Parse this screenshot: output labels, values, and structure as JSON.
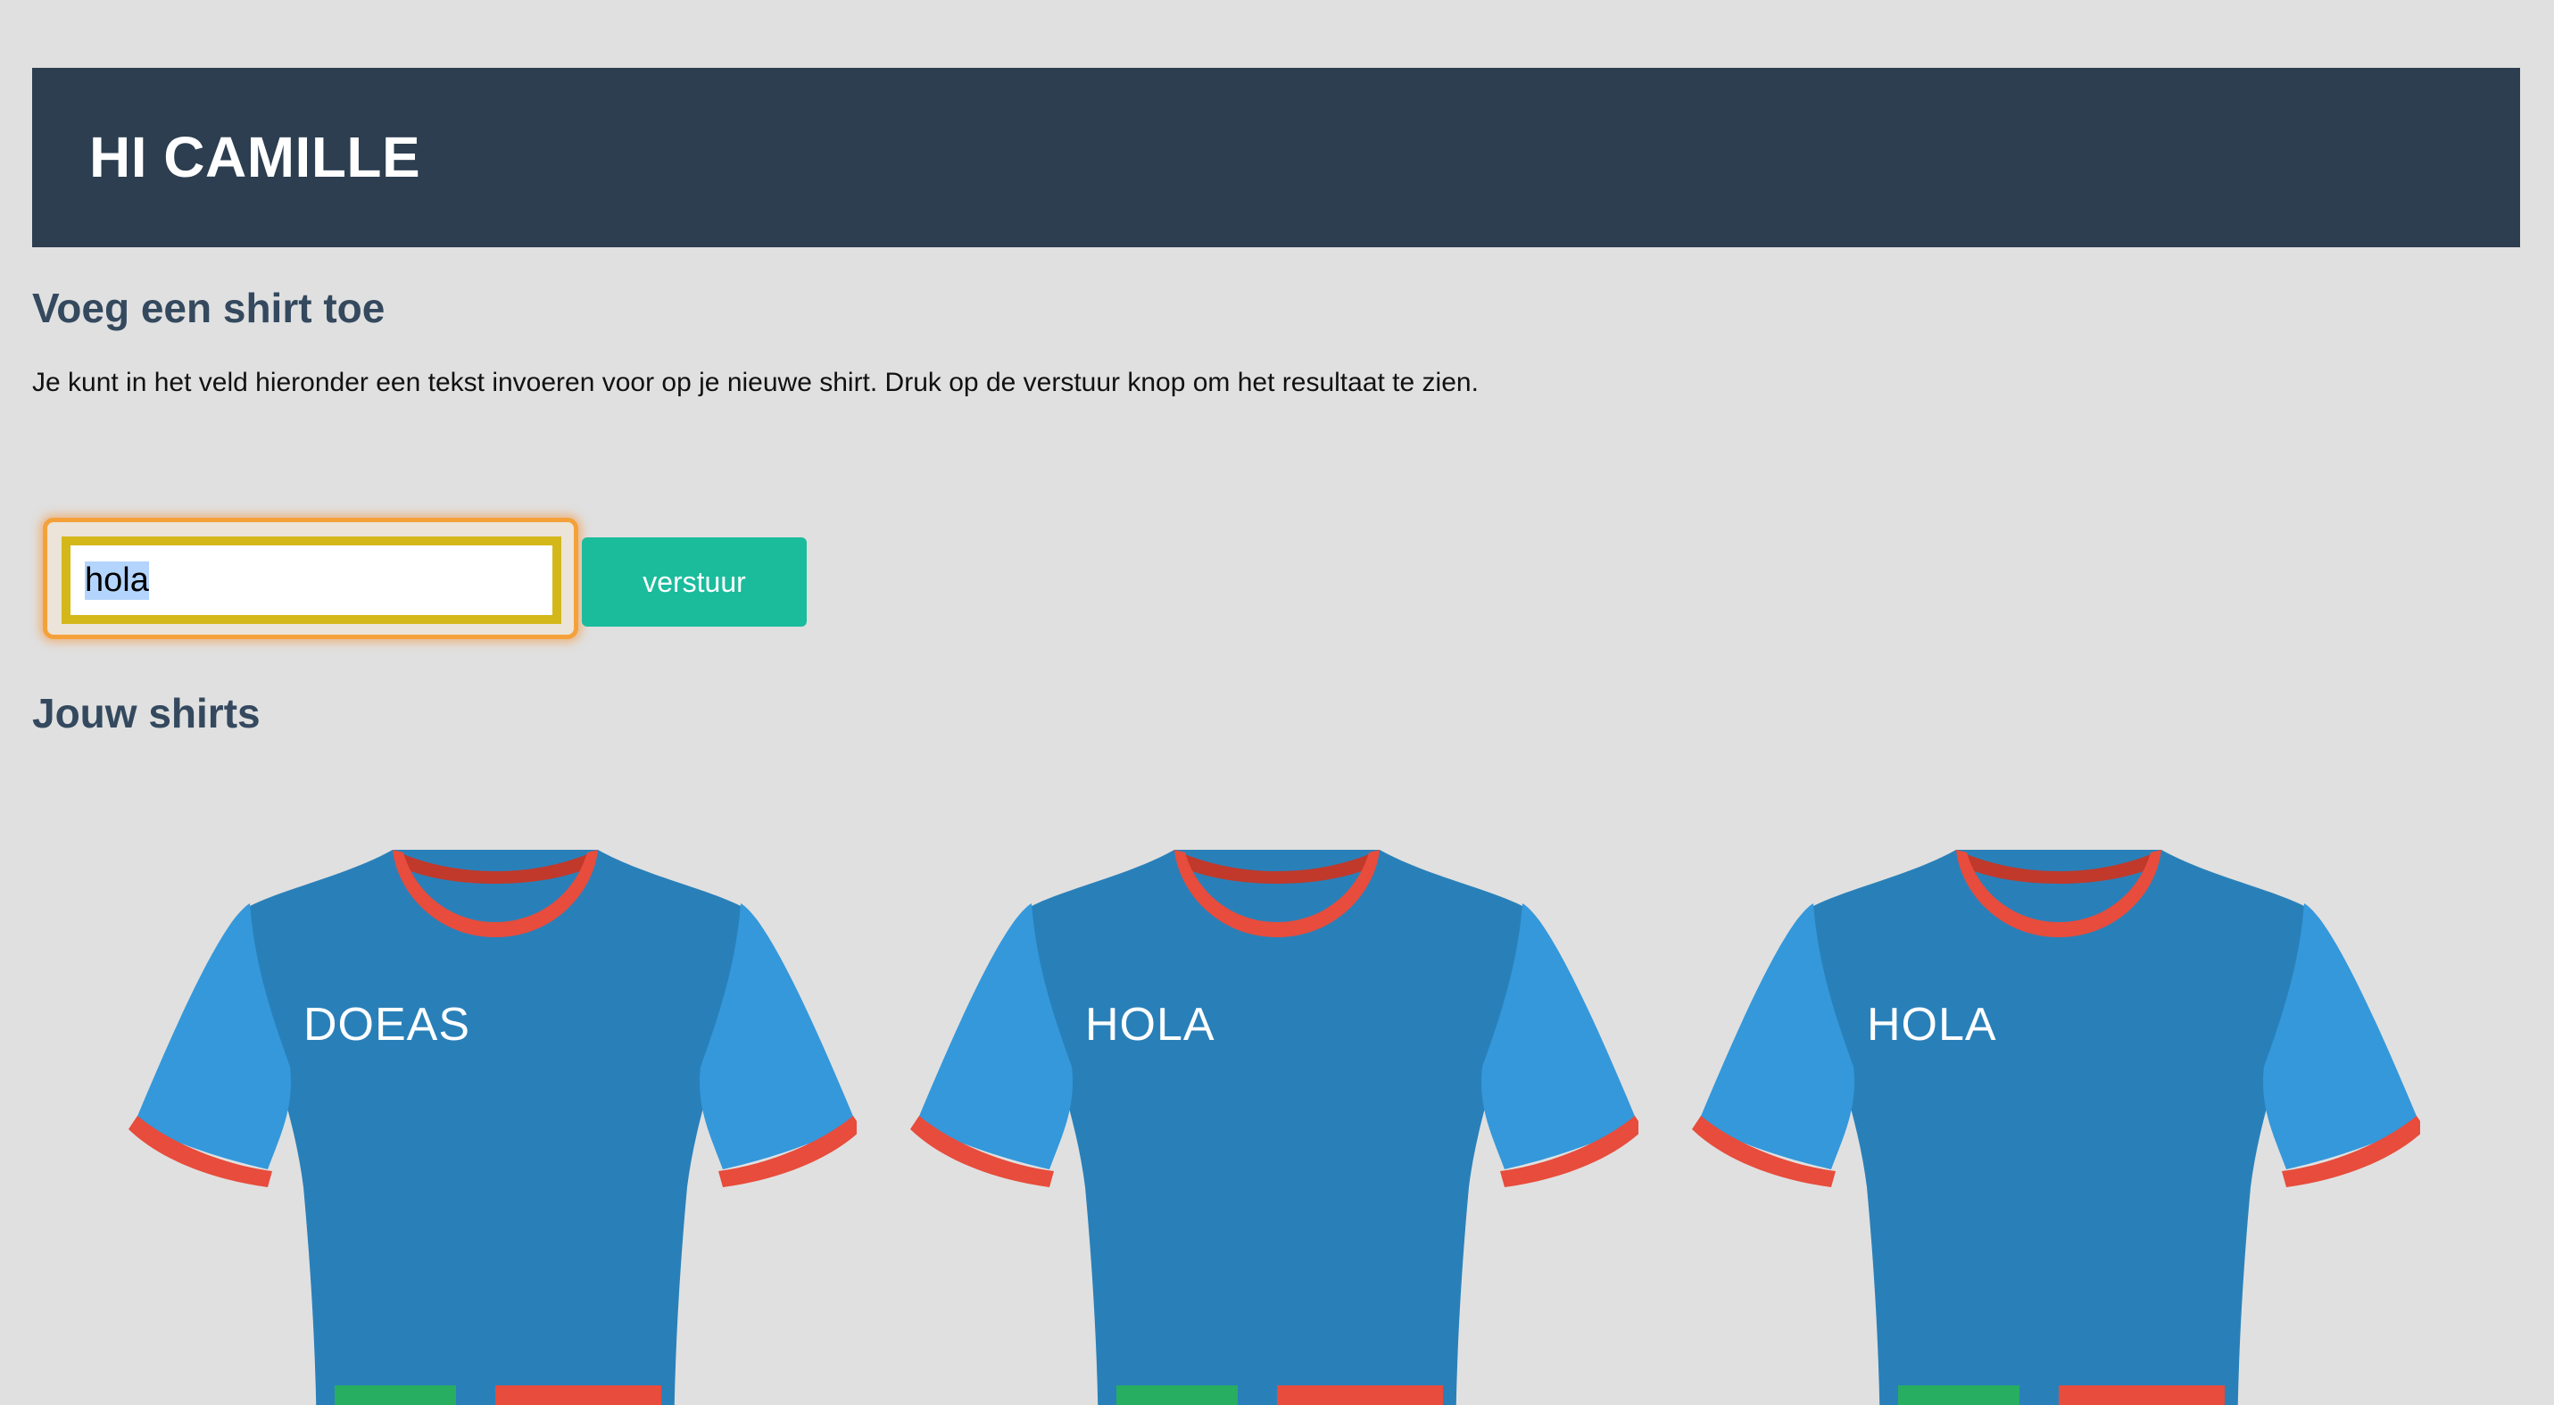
{
  "header": {
    "title": "HI CAMILLE"
  },
  "add_section": {
    "title": "Voeg een shirt toe",
    "description": "Je kunt in het veld hieronder een tekst invoeren voor op je nieuwe shirt. Druk op de verstuur knop om het resultaat te zien.",
    "input_value": "hola",
    "submit_label": "verstuur"
  },
  "shirts_section": {
    "title": "Jouw shirts",
    "shirts": [
      {
        "text": "DOEAS"
      },
      {
        "text": "HOLA"
      },
      {
        "text": "HOLA"
      }
    ]
  },
  "colors": {
    "banner": "#2c3e50",
    "heading": "#34495e",
    "button": "#1abc9c",
    "shirt_body": "#2980b9",
    "shirt_sleeve": "#3498db",
    "shirt_trim": "#e74c3c",
    "input_focus_ring": "#f4a13a",
    "input_border": "#d4b81a"
  }
}
